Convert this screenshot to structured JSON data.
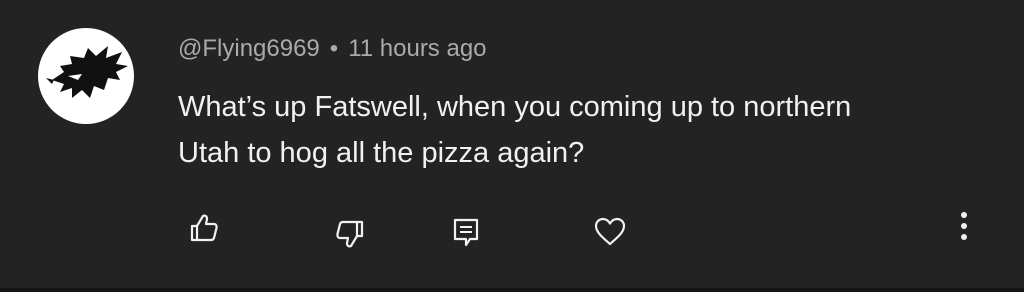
{
  "comment": {
    "author": "@Flying6969",
    "separator": "•",
    "timestamp": "11 hours ago",
    "text_line_1": "What’s up Fatswell, when you coming up to northern",
    "text_line_2": "Utah to hog all the pizza again?"
  },
  "actions": {
    "like_icon": "thumbs-up-icon",
    "dislike_icon": "thumbs-down-icon",
    "reply_icon": "reply-icon",
    "heart_icon": "heart-icon",
    "more_icon": "more-vertical-icon"
  },
  "colors": {
    "background": "#232323",
    "primary_text": "#f1f1f1",
    "secondary_text": "#aaaaaa"
  }
}
